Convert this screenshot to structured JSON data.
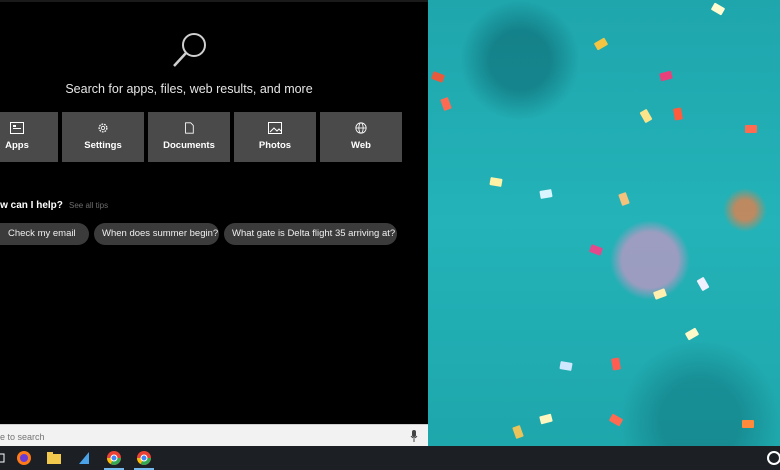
{
  "search": {
    "hint": "Search for apps, files, web results, and more",
    "box_placeholder": "ere to search"
  },
  "categories": [
    {
      "label": "Apps",
      "icon": "apps-icon"
    },
    {
      "label": "Settings",
      "icon": "gear-icon"
    },
    {
      "label": "Documents",
      "icon": "document-icon"
    },
    {
      "label": "Photos",
      "icon": "photo-icon"
    },
    {
      "label": "Web",
      "icon": "globe-icon"
    }
  ],
  "help": {
    "title": "ow can I help?",
    "see_all": "See all tips",
    "chips": [
      "Check my email",
      "When does summer begin?",
      "What gate is Delta flight 35 arriving at?"
    ]
  },
  "taskbar": {
    "icons": [
      "firefox-icon",
      "file-explorer-icon",
      "store-icon",
      "chrome-icon",
      "chrome-icon"
    ]
  },
  "colors": {
    "panel": "#000000",
    "tile": "#4a4a4a",
    "chip": "#3b3b3b",
    "wallpaper": "#1fa6ad",
    "taskbar": "#1c1f24"
  }
}
